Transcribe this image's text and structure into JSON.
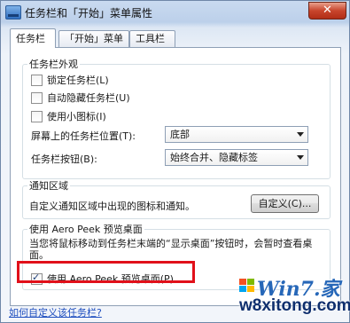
{
  "window": {
    "title": "任务栏和「开始」菜单属性",
    "close_glyph": "✕"
  },
  "tabs": [
    {
      "label": "任务栏",
      "active": true
    },
    {
      "label": "「开始」菜单",
      "active": false
    },
    {
      "label": "工具栏",
      "active": false
    }
  ],
  "appearance": {
    "legend": "任务栏外观",
    "options": [
      {
        "label": "锁定任务栏(L)",
        "checked": false
      },
      {
        "label": "自动隐藏任务栏(U)",
        "checked": false
      },
      {
        "label": "使用小图标(I)",
        "checked": false
      }
    ],
    "position_label": "屏幕上的任务栏位置(T):",
    "position_value": "底部",
    "buttons_label": "任务栏按钮(B):",
    "buttons_value": "始终合并、隐藏标签"
  },
  "notification": {
    "legend": "通知区域",
    "description": "自定义通知区域中出现的图标和通知。",
    "customize_button": "自定义(C)..."
  },
  "aero_peek": {
    "legend": "使用 Aero Peek 预览桌面",
    "description": "当您将鼠标移动到任务栏末端的“显示桌面”按钮时，会暂时查看桌面。",
    "checkbox_label": "使用 Aero Peek 预览桌面(P)",
    "checked": true
  },
  "footer": {
    "help_link": "如何自定义该任务栏?"
  },
  "watermark": {
    "line1": "Win7.家",
    "line2": "w8xitong.com"
  },
  "colors": {
    "highlight": "#e1101a",
    "link": "#1f4fbf",
    "close": "#c8452c"
  }
}
